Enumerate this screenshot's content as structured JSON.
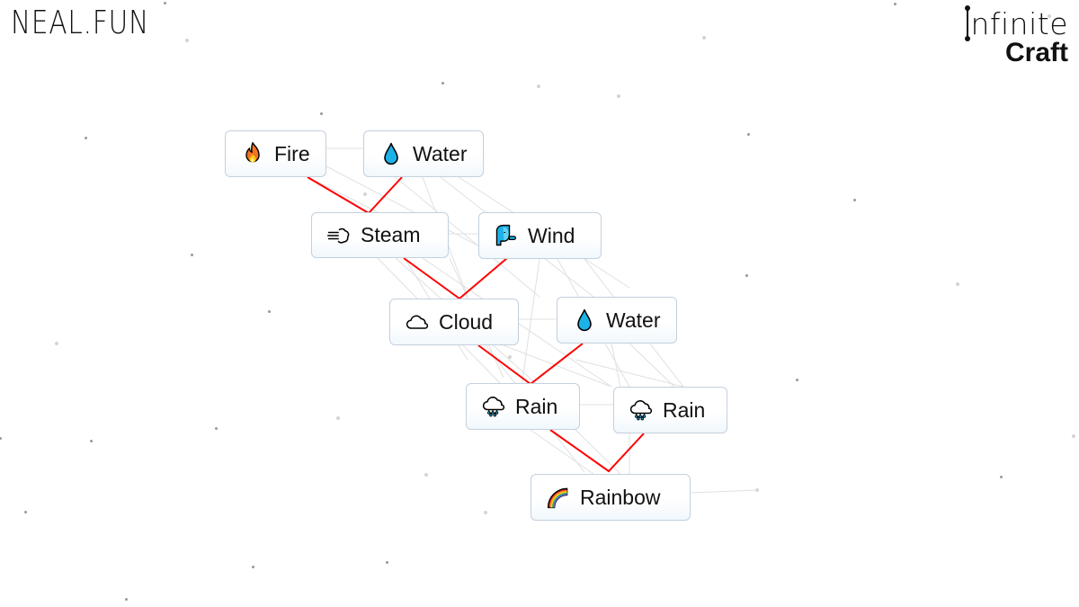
{
  "header": {
    "left_logo": "NEAL.FUN",
    "right_logo_line1": "nfinite",
    "right_logo_line2": "Craft"
  },
  "colors": {
    "recipe_line": "#ff0000",
    "connection_line": "#dcdcdc",
    "node_border": "#c3d0dd",
    "text": "#111111",
    "drop_blue": "#1cb2e8"
  },
  "nodes": [
    {
      "id": "fire",
      "label": "Fire",
      "icon": "fire-icon"
    },
    {
      "id": "water-1",
      "label": "Water",
      "icon": "water-drop-icon"
    },
    {
      "id": "steam",
      "label": "Steam",
      "icon": "steam-puff-icon"
    },
    {
      "id": "wind",
      "label": "Wind",
      "icon": "wind-face-icon"
    },
    {
      "id": "cloud",
      "label": "Cloud",
      "icon": "cloud-icon"
    },
    {
      "id": "water-2",
      "label": "Water",
      "icon": "water-drop-icon"
    },
    {
      "id": "rain-1",
      "label": "Rain",
      "icon": "rain-cloud-icon"
    },
    {
      "id": "rain-2",
      "label": "Rain",
      "icon": "rain-cloud-icon"
    },
    {
      "id": "rainbow",
      "label": "Rainbow",
      "icon": "rainbow-icon"
    }
  ],
  "recipes": [
    {
      "inputs": [
        "fire",
        "water-1"
      ],
      "output": "steam"
    },
    {
      "inputs": [
        "steam",
        "wind"
      ],
      "output": "cloud"
    },
    {
      "inputs": [
        "cloud",
        "water-2"
      ],
      "output": "rain-1"
    },
    {
      "inputs": [
        "rain-1",
        "rain-2"
      ],
      "output": "rainbow"
    }
  ]
}
